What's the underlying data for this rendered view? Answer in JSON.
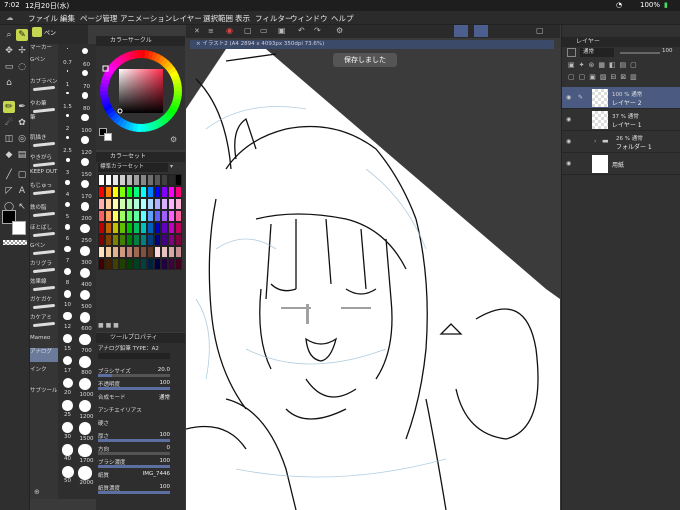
{
  "status": {
    "time": "7:02",
    "date": "12月20日(水)",
    "battery": "100%"
  },
  "menu": [
    "ファイル",
    "編集",
    "ページ管理",
    "アニメーション",
    "レイヤー",
    "選択範囲",
    "表示",
    "フィルター",
    "ウィンドウ",
    "ヘルプ"
  ],
  "subtools": {
    "tab1": "ペン",
    "tab2": "マーカー",
    "items": [
      "Gペン",
      "カブラペン",
      "やわ筆",
      "筆",
      "肌描き",
      "やきがら",
      "KEEP OUT",
      "もじゅっ",
      "鉄の脂",
      "ほとばし",
      "Gペン",
      "カリグラ",
      "効果線",
      "ガケガケ",
      "カケアミ",
      "Mameo",
      "アナログ",
      "インク",
      "サブツール"
    ]
  },
  "brush_sizes": [
    "0.7",
    "1",
    "1.5",
    "2",
    "2.5",
    "3",
    "4",
    "5",
    "6",
    "7",
    "8",
    "10",
    "12",
    "15",
    "17",
    "20",
    "25",
    "30",
    "40",
    "50",
    "60",
    "70",
    "80",
    "100",
    "120",
    "150",
    "170",
    "200",
    "250",
    "300",
    "400",
    "500",
    "600",
    "700",
    "800",
    "1000",
    "1200",
    "1500",
    "1700",
    "2000"
  ],
  "color_panel": {
    "title": "カラーサークル"
  },
  "color_set": {
    "title": "カラーセット",
    "selector": "標準カラーセット",
    "colors": [
      "#ffffff",
      "#ffffff",
      "#e8e8e8",
      "#d0d0d0",
      "#b8b8b8",
      "#a0a0a0",
      "#888888",
      "#707070",
      "#585858",
      "#404040",
      "#282828",
      "#000000",
      "#ff0000",
      "#ff8000",
      "#ffff00",
      "#80ff00",
      "#00ff00",
      "#00ff80",
      "#00ffff",
      "#0080ff",
      "#0000ff",
      "#8000ff",
      "#ff00ff",
      "#ff0080",
      "#ffb0b0",
      "#ffd0a0",
      "#ffffb0",
      "#d0ffb0",
      "#b0ffb0",
      "#b0ffd8",
      "#b0ffff",
      "#b0d8ff",
      "#b0b0ff",
      "#d8b0ff",
      "#ffb0ff",
      "#ffb0d8",
      "#ff6060",
      "#ffa060",
      "#ffff60",
      "#a0ff60",
      "#60ff60",
      "#60ffa0",
      "#60ffff",
      "#60a0ff",
      "#6060ff",
      "#a060ff",
      "#ff60ff",
      "#ff60a0",
      "#c00000",
      "#c06000",
      "#c0c000",
      "#60c000",
      "#00c000",
      "#00c060",
      "#00c0c0",
      "#0060c0",
      "#0000c0",
      "#6000c0",
      "#c000c0",
      "#c00060",
      "#800000",
      "#804000",
      "#808000",
      "#408000",
      "#008000",
      "#008040",
      "#008080",
      "#004080",
      "#000080",
      "#400080",
      "#800080",
      "#800040",
      "#ffe0c0",
      "#f0c8a0",
      "#e0b090",
      "#d09880",
      "#c08070",
      "#a06850",
      "#805040",
      "#603828",
      "#f8d8d8",
      "#e8c0c0",
      "#d8a8a8",
      "#c89090",
      "#400000",
      "#402000",
      "#404000",
      "#204000",
      "#004000",
      "#004020",
      "#004040",
      "#002040",
      "#000040",
      "#200040",
      "#400040",
      "#400020"
    ]
  },
  "tool_props": {
    "title": "ツールプロパティ",
    "subtitle": "アナログ鉛筆 TYPE：A2",
    "rows": [
      {
        "label": "ブラシサイズ",
        "value": "20.0"
      },
      {
        "label": "不透明度",
        "value": "100"
      },
      {
        "label": "合成モード",
        "value": "通常"
      },
      {
        "label": "アンチエイリアス",
        "value": ""
      },
      {
        "label": "硬さ",
        "value": ""
      },
      {
        "label": "厚さ",
        "value": "100"
      },
      {
        "label": "方向",
        "value": "0"
      },
      {
        "label": "ブラシ濃度",
        "value": "100"
      },
      {
        "label": "紙質",
        "value": "IMG_7446"
      },
      {
        "label": "紙質濃度",
        "value": "100"
      }
    ]
  },
  "canvas": {
    "doc_tab": "× イラスト2 (A4 2894 x 4093px 350dpi 73.6%)",
    "toast": "保存しました"
  },
  "layers": {
    "title": "レイヤー",
    "blend": "通常",
    "opacity": "100",
    "items": [
      {
        "meta": "100 % 通常",
        "name": "レイヤー 2",
        "selected": true
      },
      {
        "meta": "37 % 通常",
        "name": "レイヤー 1",
        "selected": false
      },
      {
        "meta": "26 % 通常",
        "name": "フォルダー 1",
        "selected": false
      },
      {
        "meta": "",
        "name": "用紙",
        "selected": false
      }
    ]
  }
}
